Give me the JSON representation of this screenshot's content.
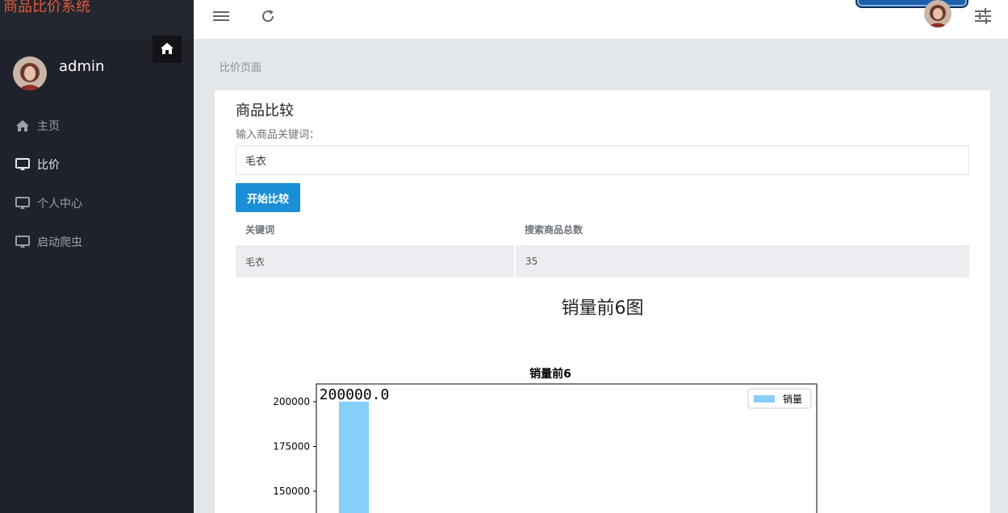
{
  "app": {
    "title": "商品比价系统"
  },
  "user": {
    "name": "admin"
  },
  "sidebar": {
    "items": [
      {
        "label": "主页",
        "icon": "home-icon"
      },
      {
        "label": "比价",
        "icon": "monitor-icon"
      },
      {
        "label": "个人中心",
        "icon": "monitor-icon"
      },
      {
        "label": "启动爬虫",
        "icon": "monitor-icon"
      }
    ]
  },
  "breadcrumb": {
    "current": "比价页面"
  },
  "main": {
    "title": "商品比较",
    "input_label": "输入商品关键词：",
    "input_value": "毛衣",
    "compare_button": "开始比较",
    "table": {
      "headers": [
        "关键词",
        "搜索商品总数"
      ],
      "rows": [
        [
          "毛衣",
          "35"
        ]
      ]
    },
    "section_title": "销量前6图"
  },
  "chart_data": {
    "type": "bar",
    "title": "销量前6",
    "series": [
      {
        "name": "销量",
        "values": [
          200000.0
        ]
      }
    ],
    "value_labels": [
      "200000.0"
    ],
    "yticks": [
      "200000",
      "175000",
      "150000"
    ],
    "ytick_values": [
      200000,
      175000,
      150000
    ],
    "legend": "top-right",
    "bar_color": "#87cefa"
  },
  "colors": {
    "sidebar_bg": "#1f222b",
    "brand": "#e05a3a",
    "primary_button": "#1b8fd6"
  }
}
